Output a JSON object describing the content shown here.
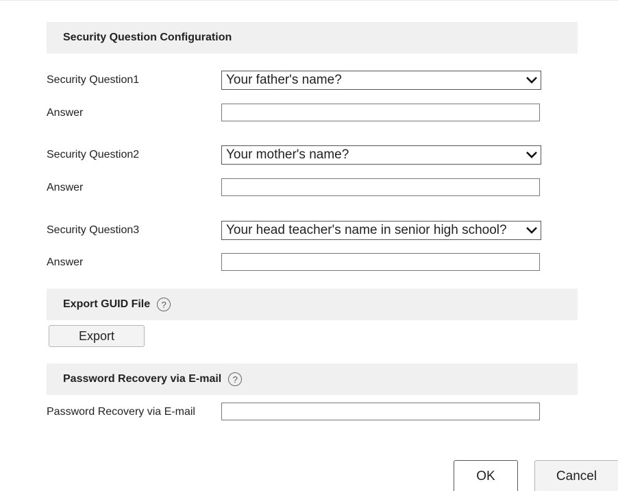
{
  "security_section": {
    "title": "Security Question Configuration",
    "questions": [
      {
        "label": "Security Question1",
        "selected": "Your father's name?",
        "answer_label": "Answer",
        "answer_value": ""
      },
      {
        "label": "Security Question2",
        "selected": "Your mother's name?",
        "answer_label": "Answer",
        "answer_value": ""
      },
      {
        "label": "Security Question3",
        "selected": "Your head teacher's name in senior high school?",
        "answer_label": "Answer",
        "answer_value": ""
      }
    ],
    "dropdown_icon": "chevron-down-icon"
  },
  "guid_section": {
    "title": "Export GUID File",
    "help_icon": "help-icon",
    "help_glyph": "?",
    "export_label": "Export"
  },
  "email_section": {
    "title": "Password Recovery via E-mail",
    "help_icon": "help-icon",
    "help_glyph": "?",
    "field_label": "Password Recovery via E-mail",
    "field_value": ""
  },
  "footer": {
    "ok_label": "OK",
    "cancel_label": "Cancel"
  }
}
